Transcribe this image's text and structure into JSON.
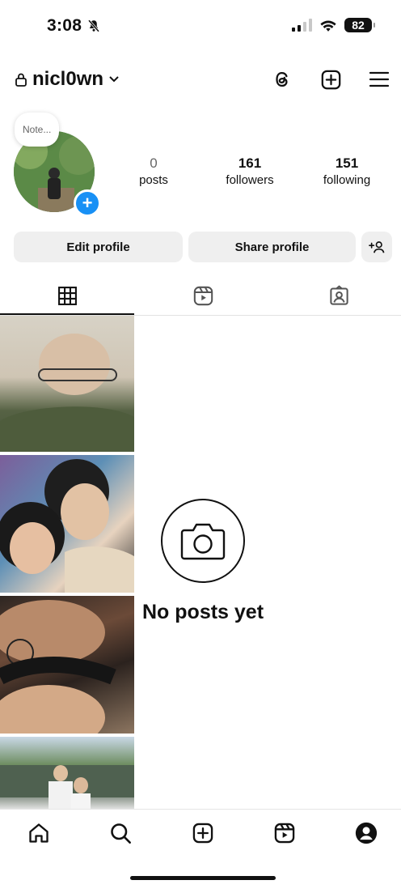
{
  "status_bar": {
    "time": "3:08",
    "battery": "82"
  },
  "header": {
    "username": "nicl0wn"
  },
  "profile": {
    "note": "Note...",
    "stats": [
      {
        "value": "0",
        "label": "posts"
      },
      {
        "value": "161",
        "label": "followers"
      },
      {
        "value": "151",
        "label": "following"
      }
    ]
  },
  "buttons": {
    "edit": "Edit profile",
    "share": "Share profile"
  },
  "empty_state": {
    "text": "No posts yet"
  },
  "colors": {
    "accent": "#1890f5",
    "button_bg": "#efefef"
  },
  "icons": {
    "header": [
      "threads-icon",
      "create-icon",
      "menu-icon"
    ],
    "tabs": [
      "grid-icon",
      "reels-icon",
      "tagged-icon"
    ],
    "nav": [
      "home-icon",
      "search-icon",
      "create-icon",
      "reels-icon",
      "profile-icon"
    ]
  }
}
